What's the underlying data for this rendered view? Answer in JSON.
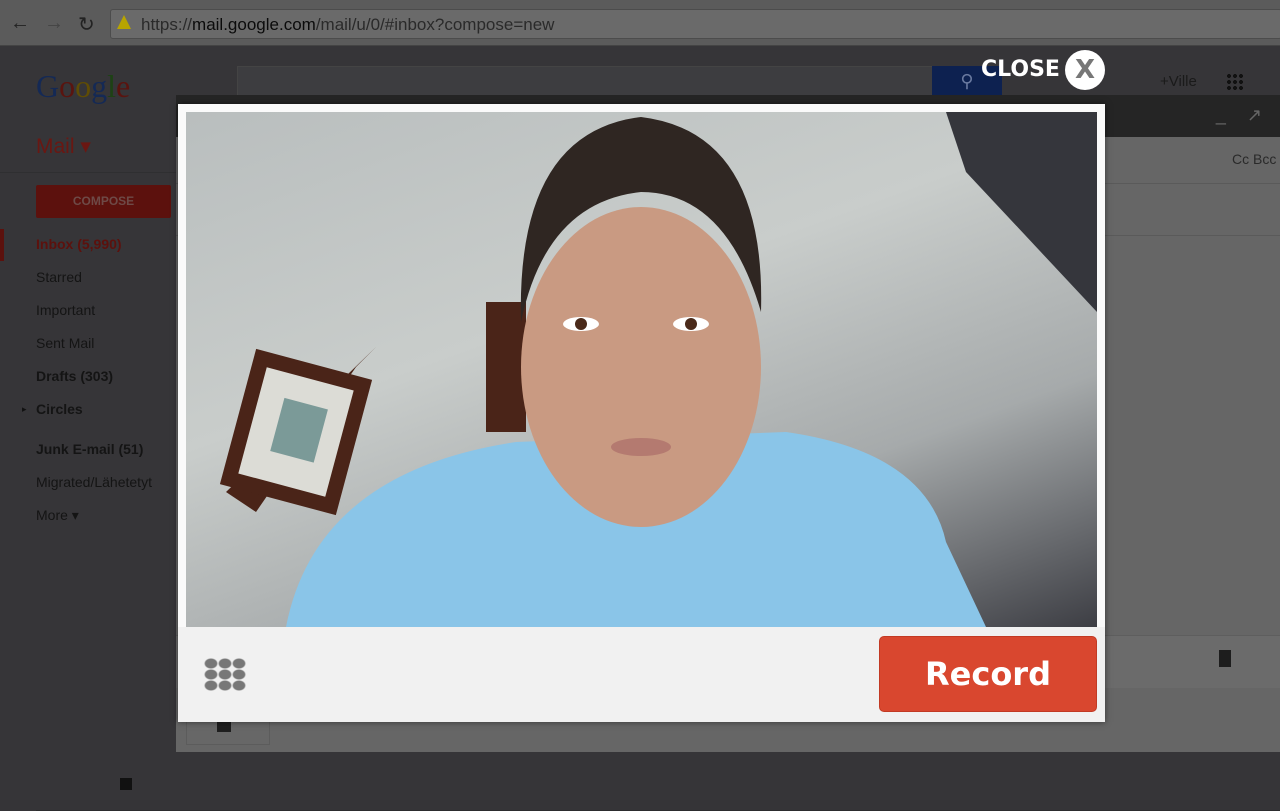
{
  "browser": {
    "url_prefix": "https://",
    "url_host": "mail.google.com",
    "url_path": "/mail/u/0/#inbox?compose=new",
    "back_icon": "arrow-left",
    "forward_icon": "arrow-right",
    "reload_icon": "reload"
  },
  "gmail": {
    "logo": "Google",
    "mail_label": "Mail ▾",
    "compose_label": "COMPOSE",
    "user": "+Ville",
    "nav": [
      {
        "label": "Inbox (5,990)",
        "bold": true,
        "active": true
      },
      {
        "label": "Starred"
      },
      {
        "label": "Important"
      },
      {
        "label": "Sent Mail"
      },
      {
        "label": "Drafts (303)",
        "bold": true
      },
      {
        "label": "Circles",
        "bold": true
      },
      {
        "label": "Junk E-mail (51)",
        "bold": true
      },
      {
        "label": "Migrated/Lähetetyt"
      },
      {
        "label": "More ▾"
      }
    ],
    "compose_window": {
      "controls": "_ ↗",
      "cc_bcc": "Cc  Bcc"
    }
  },
  "overlay": {
    "close_label": "CLOSE",
    "close_x": "X",
    "record_label": "Record",
    "accent": "#d9472f"
  }
}
